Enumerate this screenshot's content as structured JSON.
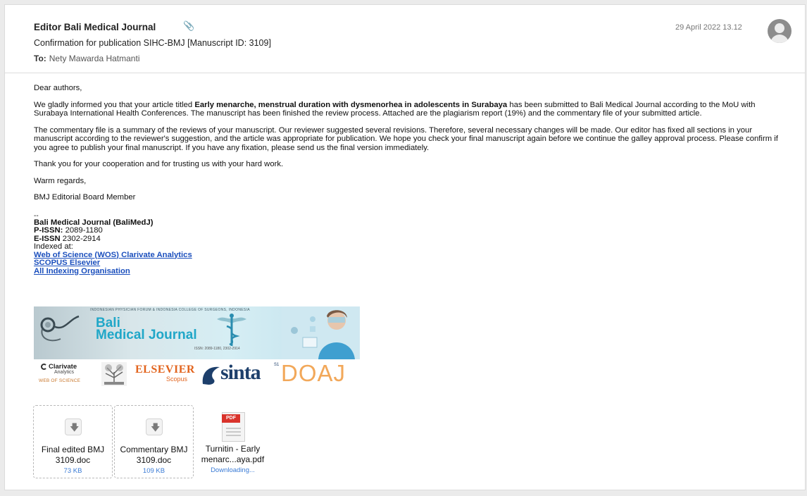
{
  "header": {
    "sender": "Editor Bali Medical Journal",
    "subject": "Confirmation for publication SIHC-BMJ [Manuscript ID: 3109]",
    "to_label": "To:",
    "to_value": "Nety Mawarda Hatmanti",
    "date": "29 April 2022 13.12",
    "attachment_icon": "paperclip-icon",
    "avatar_icon": "user-avatar-icon"
  },
  "body": {
    "greeting": "Dear authors,",
    "p1_before": "We gladly informed you that your article titled ",
    "p1_title": "Early menarche, menstrual duration with dysmenorhea in adolescents in Surabaya",
    "p1_after": " has been submitted to Bali Medical Journal according to the MoU with Surabaya International Health Conferences. The manuscript has been finished the review process. Attached are the plagiarism report (19%) and the commentary file of your submitted article.",
    "p2": "The commentary file is a summary of the reviews of your manuscript. Our reviewer suggested several revisions. Therefore, several necessary changes will be made. Our editor has fixed all sections in your manuscript according to the reviewer's suggestion, and the article was appropriate for publication. We hope you check your final manuscript again before we continue the galley approval process. Please confirm if you agree to publish your final manuscript. If you have any fixation, please send us the final version immediately.",
    "p3": "Thank you for your cooperation and for trusting us with your hard work.",
    "closing": "Warm regards,",
    "signer": "BMJ Editorial Board Member"
  },
  "signature": {
    "dash": "--",
    "journal": "Bali Medical Journal (BaliMedJ)",
    "pissn_label": "P-ISSN:",
    "pissn_value": " 2089-1180",
    "eissn_label": "E-ISSN",
    "eissn_value": " 2302-2914",
    "indexed": "Indexed at:",
    "links": [
      "Web of Science (WOS) Clarivate Analytics",
      "SCOPUS Elsevier",
      "All Indexing Organisation"
    ]
  },
  "banner": {
    "tagline": "INDONESIAN PHYSICIAN FORUM & INDONESIA COLLEGE OF SURGEONS, INDONESIA",
    "bali": "Bali",
    "medical_journal": "Medical Journal",
    "issn": "ISSN: 2089-1180, 2302-2914",
    "clarivate": "Clarivate",
    "analytics": "Analytics",
    "web_of_science": "WEB OF SCIENCE",
    "elsevier": "ELSEVIER",
    "scopus": "Scopus",
    "sinta": "sinta",
    "sinta_level": "S1",
    "doaj": "DOAJ"
  },
  "attachments": [
    {
      "name": "Final edited BMJ 3109.doc",
      "size": "73 KB",
      "icon": "download-icon"
    },
    {
      "name": "Commentary BMJ 3109.doc",
      "size": "109 KB",
      "icon": "download-icon"
    },
    {
      "name": "Turnitin - Early menarc...aya.pdf",
      "status": "Downloading...",
      "icon": "pdf-file-icon",
      "pdf_label": "PDF"
    }
  ],
  "colors": {
    "link": "#1b4fbd",
    "size_text": "#3a7bd5",
    "journal_blue": "#20a7c8",
    "elsevier_orange": "#e2641e",
    "doaj_orange": "#f2a85a",
    "pdf_red": "#d9332b"
  }
}
